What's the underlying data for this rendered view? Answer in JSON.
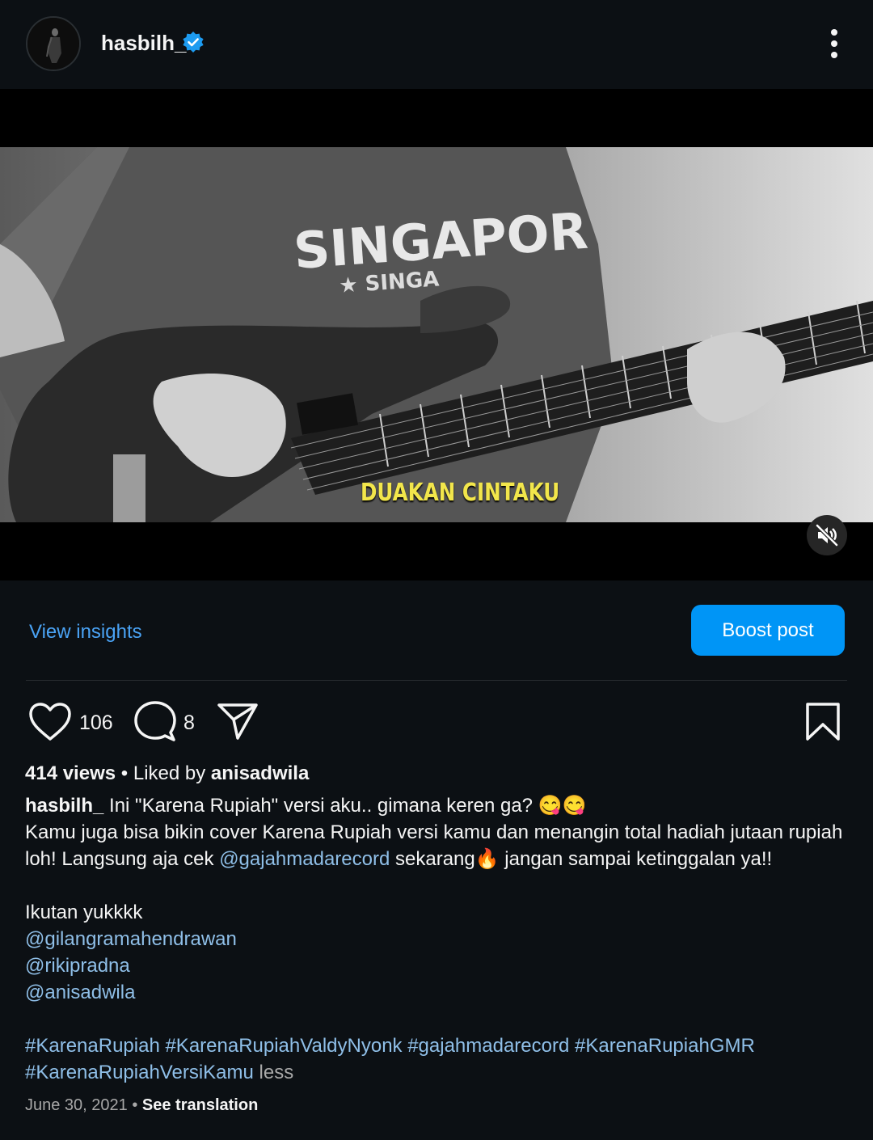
{
  "post": {
    "username": "hasbilh_",
    "video_overlay_text": "DUAKAN CINTAKU",
    "shirt_text": "SINGAPORE"
  },
  "insights": {
    "view_insights": "View insights",
    "boost_post": "Boost post"
  },
  "actions": {
    "likes": "106",
    "comments": "8"
  },
  "stats": {
    "views": "414 views",
    "separator": " • ",
    "liked_by_prefix": "Liked by ",
    "liked_by_user": "anisadwila"
  },
  "caption": {
    "author": "hasbilh_",
    "line1": " Ini \"Karena Rupiah\" versi aku.. gimana keren ga? 😋😋",
    "line2": "Kamu juga bisa bikin cover Karena Rupiah versi kamu dan menangin total hadiah jutaan rupiah",
    "line3_prefix": "loh! Langsung aja cek ",
    "line3_mention": "@gajahmadarecord",
    "line3_suffix": " sekarang🔥 jangan sampai ketinggalan ya!!",
    "ikutan": "Ikutan yukkkk",
    "mentions": [
      "@gilangramahendrawan",
      "@rikipradna",
      "@anisadwila"
    ],
    "hashtags_line1": "#KarenaRupiah #KarenaRupiahValdyNyonk #gajahmadarecord #KarenaRupiahGMR",
    "hashtags_line2": "#KarenaRupiahVersiKamu",
    "less": " less"
  },
  "meta": {
    "date": "June 30, 2021",
    "dot": " • ",
    "see_translation": "See translation"
  },
  "colors": {
    "background": "#0c1014",
    "accent_blue": "#0095f6",
    "link_blue": "#4aa3f5",
    "mention_blue": "#8fbfe8",
    "verified_blue": "#1d9bf0",
    "overlay_yellow": "#f2e64b"
  },
  "icons": {
    "verified": "verified-badge-icon",
    "more": "more-vertical-icon",
    "mute": "muted-speaker-icon",
    "like": "heart-icon",
    "comment": "comment-bubble-icon",
    "share": "paper-plane-icon",
    "save": "bookmark-icon"
  }
}
